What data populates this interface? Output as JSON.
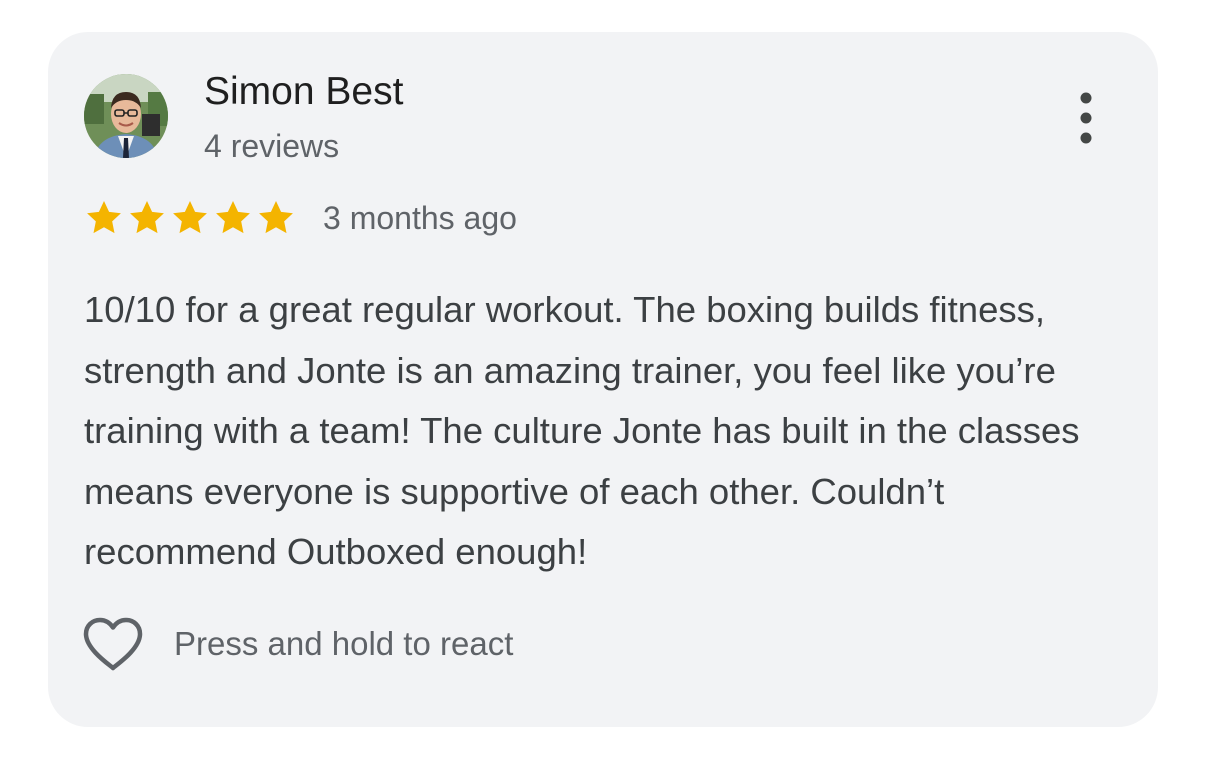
{
  "review": {
    "author_name": "Simon Best",
    "author_reviews": "4 reviews",
    "rating": 5,
    "rating_max": 5,
    "date": "3 months ago",
    "text": "10/10 for a great regular workout. The boxing builds fitness, strength and Jonte is an amazing trainer, you feel like you’re training with a team! The culture Jonte has built in the classes means everyone is supportive of each other. Couldn’t recommend Outboxed enough!",
    "react_label": "Press and hold to react"
  },
  "icons": {
    "avatar": "profile-photo",
    "menu": "more-vert-icon",
    "star": "star-icon",
    "react": "heart-outline-icon"
  },
  "colors": {
    "card_background": "#f2f3f5",
    "star": "#f4b400",
    "primary_text": "#1f1f1f",
    "secondary_text": "#5f6368",
    "body_text": "#3c4043"
  }
}
